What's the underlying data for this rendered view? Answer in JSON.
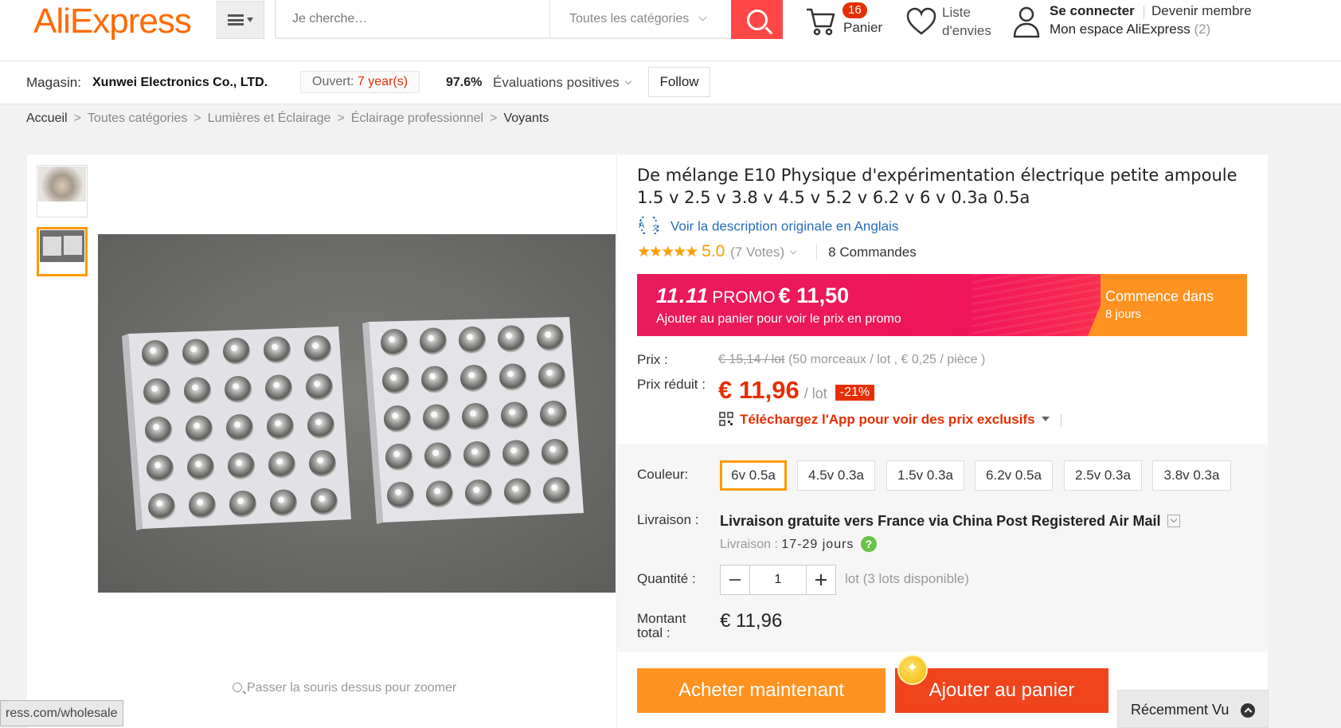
{
  "header": {
    "logo": "AliExpress",
    "search_placeholder": "Je cherche…",
    "category": "Toutes les catégories",
    "cart_count": "16",
    "cart_label": "Panier",
    "wishlist_label": "Liste d'envies",
    "signin": "Se connecter",
    "join": "Devenir membre",
    "account": "Mon espace AliExpress",
    "account_count": "(2)"
  },
  "store": {
    "label": "Magasin:",
    "name": "Xunwei Electronics Co., LTD.",
    "open_prefix": "Ouvert:",
    "open_years": "7 year(s)",
    "rating_pct": "97.6%",
    "rating_label": "Évaluations positives",
    "follow": "Follow"
  },
  "breadcrumb": [
    "Accueil",
    "Toutes catégories",
    "Lumières et Éclairage",
    "Éclairage professionnel",
    "Voyants"
  ],
  "product": {
    "title": "De mélange E10 Physique d'expérimentation électrique petite ampoule 1.5 v 2.5 v 3.8 v 4.5 v 5.2 v 6.2 v 6 v 0.3a 0.5a",
    "translate_link": "Voir la description originale en Anglais",
    "stars": "★★★★★",
    "score": "5.0",
    "votes": "(7 Votes)",
    "orders": "8 Commandes",
    "zoom_hint": "Passer la souris dessus pour zoomer"
  },
  "promo": {
    "tag": "11.11",
    "word": "PROMO",
    "price": "€ 11,50",
    "sub": "Ajouter au panier pour voir le prix en promo",
    "starts": "Commence dans",
    "days": "8 jours"
  },
  "pricing": {
    "price_label": "Prix :",
    "original": "€ 15,14 / lot",
    "pack_info": "(50 morceaux / lot , € 0,25 / pièce )",
    "reduced_label": "Prix réduit :",
    "sale": "€ 11,96",
    "unit": "/ lot",
    "discount": "-21%",
    "app_promo": "Téléchargez l'App pour voir des prix exclusifs"
  },
  "options": {
    "color_label": "Couleur:",
    "colors": [
      "6v 0.5a",
      "4.5v 0.3a",
      "1.5v 0.3a",
      "6.2v 0.5a",
      "2.5v 0.3a",
      "3.8v 0.3a"
    ],
    "selected_color": "6v 0.5a",
    "shipping_label": "Livraison :",
    "shipping_method": "Livraison gratuite vers France via China Post Registered Air Mail",
    "shipping_time_label": "Livraison :",
    "shipping_days": "17-29 jours",
    "qty_label": "Quantité :",
    "qty": "1",
    "qty_avail": "lot (3 lots disponible)",
    "total_label": "Montant total :",
    "total": "€ 11,96"
  },
  "actions": {
    "buy": "Acheter maintenant",
    "add": "Ajouter au panier"
  },
  "footer": {
    "recent": "Récemment Vu",
    "status_url": "ress.com/wholesale"
  },
  "colors": {
    "brand_orange": "#ff6a00",
    "search_red": "#ff4747",
    "price_red": "#e62e04",
    "promo_pink": "#f0155a",
    "promo_orange": "#ff9220"
  }
}
